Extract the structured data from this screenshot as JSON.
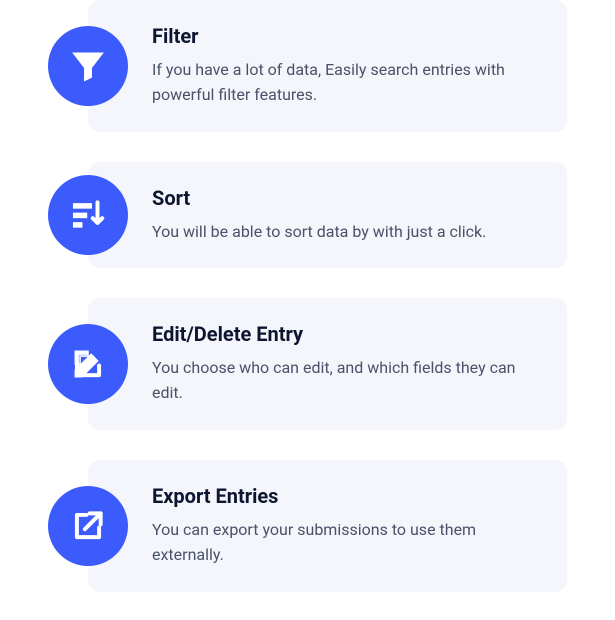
{
  "features": [
    {
      "icon": "filter",
      "title": "Filter",
      "description": "If you have a lot of data, Easily search entries with powerful filter features."
    },
    {
      "icon": "sort",
      "title": "Sort",
      "description": "You will be able to sort data by with just a click."
    },
    {
      "icon": "edit",
      "title": "Edit/Delete Entry",
      "description": "You choose who can edit, and which fields they can edit."
    },
    {
      "icon": "export",
      "title": "Export Entries",
      "description": "You can export your submissions to use them externally."
    }
  ]
}
